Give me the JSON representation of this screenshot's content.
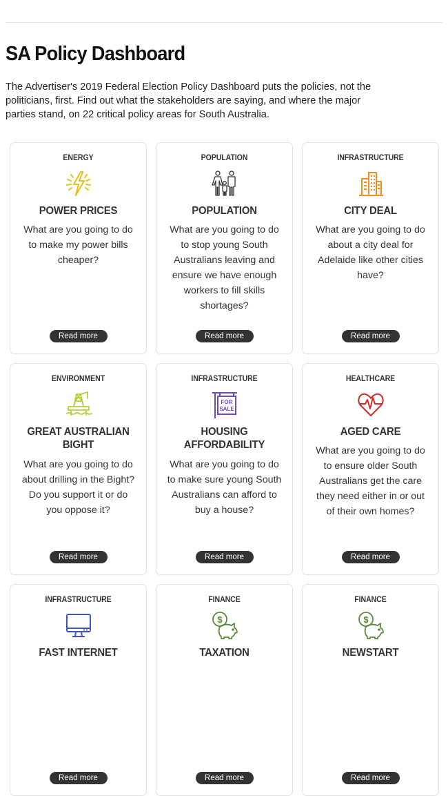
{
  "page": {
    "title": "SA Policy Dashboard",
    "intro": "The Advertiser's 2019 Federal Election Policy Dashboard puts the policies, not the politicians, first. Find out what the stakeholders are saying, and where the major parties stand, on 22 critical policy areas for South Australia."
  },
  "cards": [
    {
      "category": "ENERGY",
      "title": "POWER PRICES",
      "icon": "lightning-bolt-icon",
      "color": "#e0c21c",
      "question": "What are you going to do to make my power bills cheaper?",
      "button": "Read more"
    },
    {
      "category": "POPULATION",
      "title": "POPULATION",
      "icon": "family-icon",
      "color": "#333333",
      "question": "What are you going to do to stop young South Australians leaving and ensure we have enough workers to fill skills shortages?",
      "button": "Read more"
    },
    {
      "category": "INFRASTRUCTURE",
      "title": "CITY DEAL",
      "icon": "city-buildings-icon",
      "color": "#f08c1a",
      "question": "What are you going to do about a city deal for Adelaide like other cities have?",
      "button": "Read more"
    },
    {
      "category": "ENVIRONMENT",
      "title": "GREAT AUSTRALIAN BIGHT",
      "icon": "oil-rig-icon",
      "color": "#b5cf3a",
      "question": "What are you going to do about drilling in the Bight? Do you support it or do you oppose it?",
      "button": "Read more"
    },
    {
      "category": "INFRASTRUCTURE",
      "title": "HOUSING AFFORDABILITY",
      "icon": "for-sale-sign-icon",
      "color": "#6a4bc4",
      "question": "What are you going to do to make sure young South Australians can afford to buy a house?",
      "button": "Read more"
    },
    {
      "category": "HEALTHCARE",
      "title": "AGED CARE",
      "icon": "heartbeat-icon",
      "color": "#d62828",
      "question": "What are you going to do to ensure older South Australians get the care they need either in or out of their own homes?",
      "button": "Read more"
    },
    {
      "category": "INFRASTRUCTURE",
      "title": "FAST INTERNET",
      "icon": "computer-monitor-icon",
      "color": "#3b56c9",
      "question": "",
      "button": "Read more"
    },
    {
      "category": "FINANCE",
      "title": "TAXATION",
      "icon": "piggy-bank-icon",
      "color": "#5a8a3a",
      "question": "",
      "button": "Read more"
    },
    {
      "category": "FINANCE",
      "title": "NEWSTART",
      "icon": "piggy-bank-icon",
      "color": "#5a8a3a",
      "question": "",
      "button": "Read more"
    }
  ]
}
